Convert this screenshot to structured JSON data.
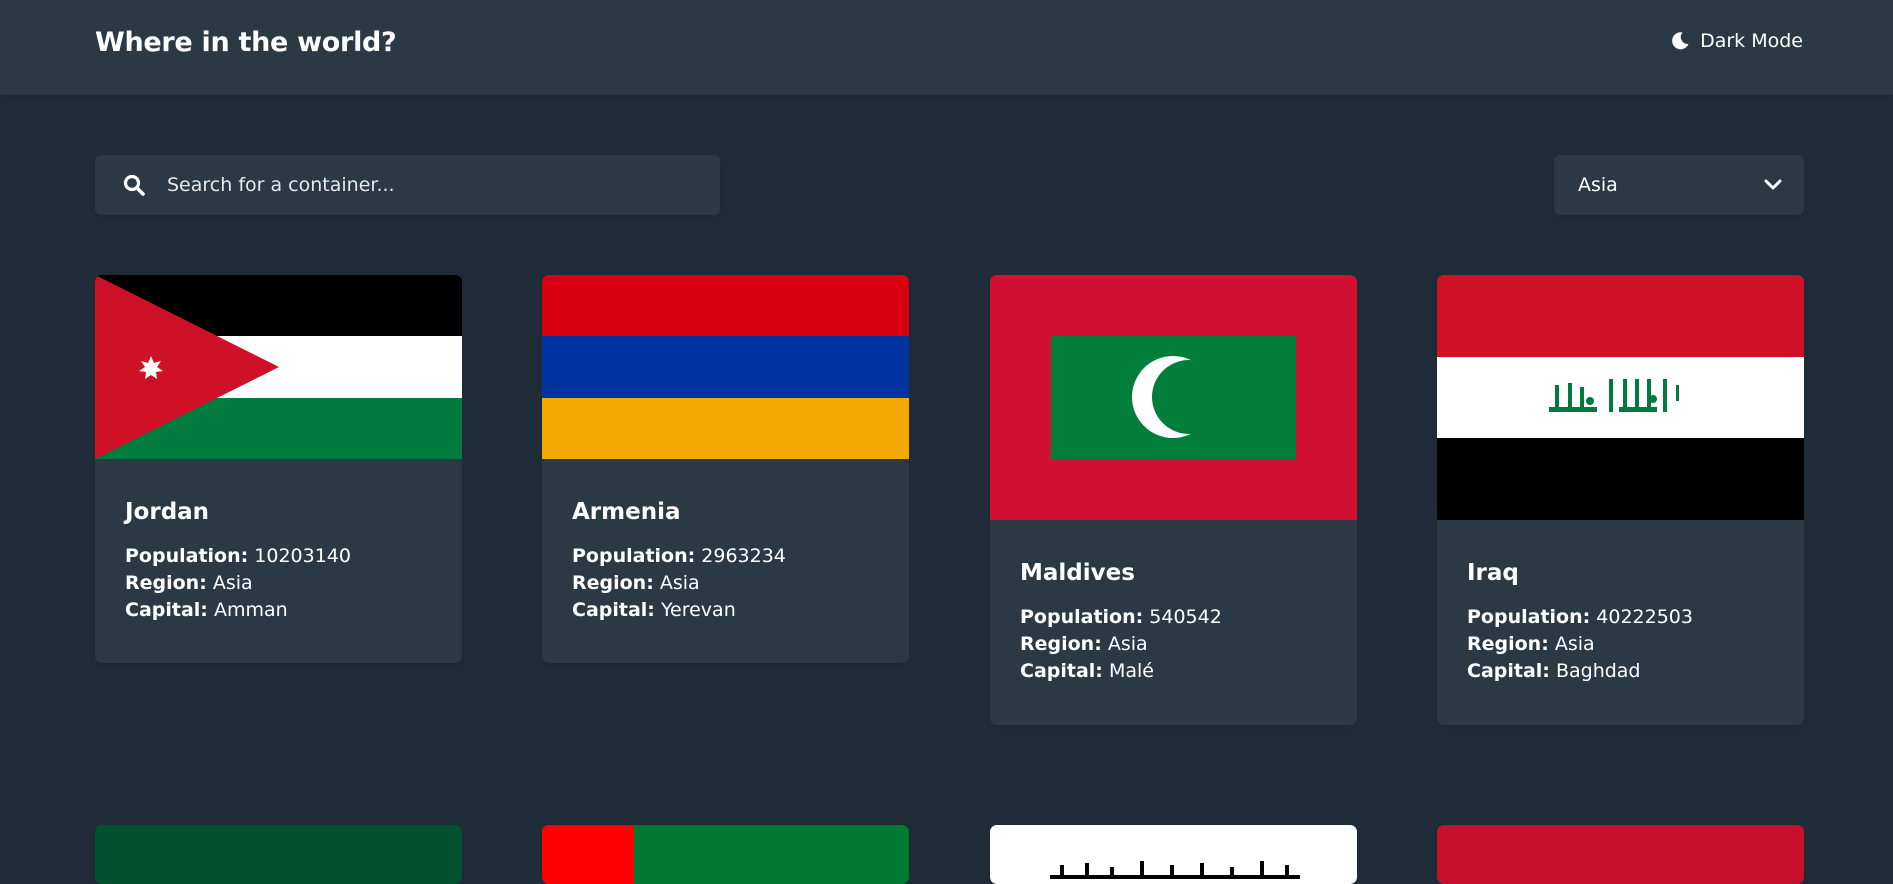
{
  "header": {
    "title": "Where in the world?",
    "theme_toggle_label": "Dark Mode",
    "theme_icon": "moon-icon"
  },
  "search": {
    "placeholder": "Search for a container...",
    "value": "",
    "icon": "search-icon"
  },
  "filter": {
    "selected": "Asia",
    "icon": "chevron-down-icon"
  },
  "labels": {
    "population": "Population:",
    "region": "Region:",
    "capital": "Capital:"
  },
  "countries": [
    {
      "name": "Jordan",
      "population": "10203140",
      "region": "Asia",
      "capital": "Amman"
    },
    {
      "name": "Armenia",
      "population": "2963234",
      "region": "Asia",
      "capital": "Yerevan"
    },
    {
      "name": "Maldives",
      "population": "540542",
      "region": "Asia",
      "capital": "Malé"
    },
    {
      "name": "Iraq",
      "population": "40222503",
      "region": "Asia",
      "capital": "Baghdad"
    }
  ],
  "colors": {
    "background": "#202c37",
    "surface": "#2b3945",
    "text": "#ffffff"
  }
}
